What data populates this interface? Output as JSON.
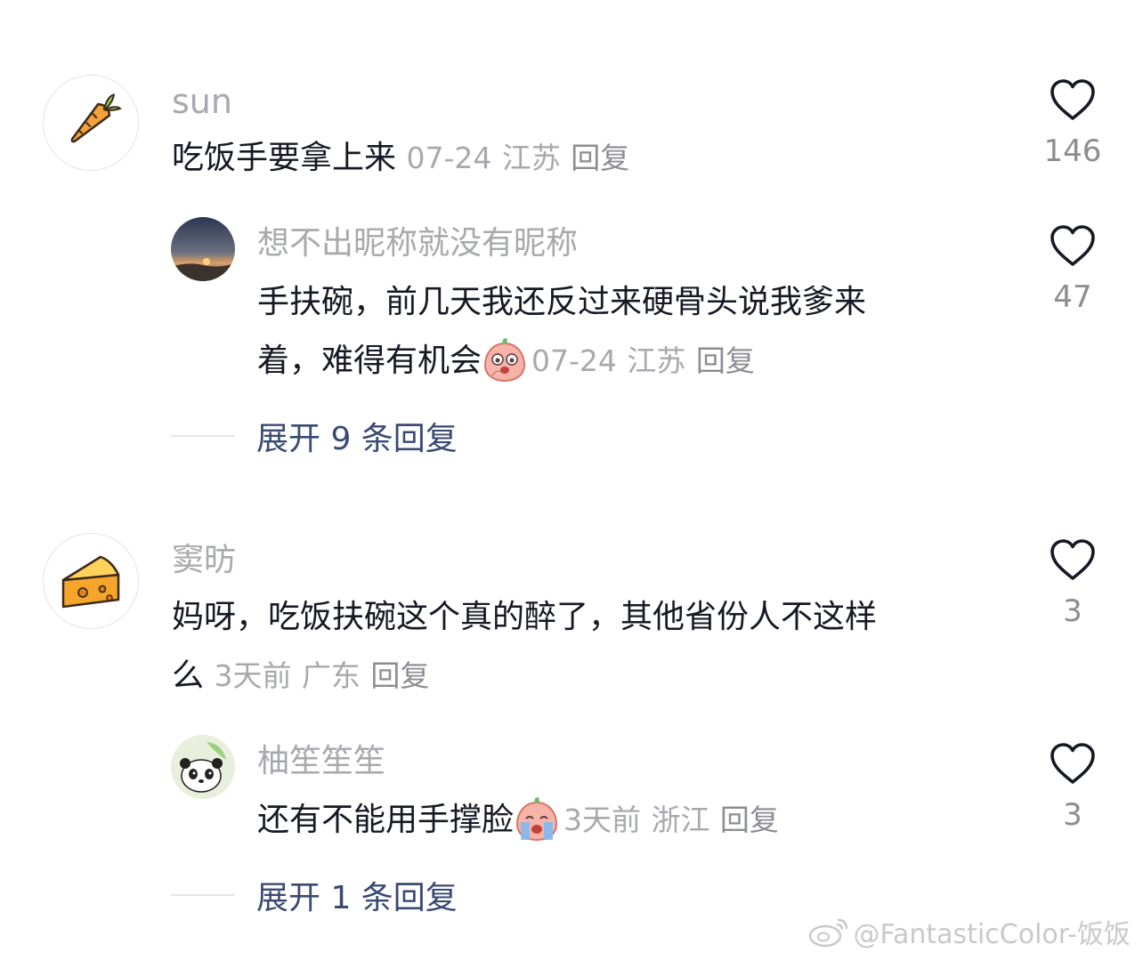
{
  "comments": [
    {
      "username": "sun",
      "avatar_icon": "carrot-icon",
      "text": "吃饭手要拿上来",
      "date": "07-24",
      "location": "江苏",
      "reply_label": "回复",
      "likes": "146",
      "replies": [
        {
          "username": "想不出昵称就没有昵称",
          "avatar_icon": "sunset-photo-avatar",
          "text_line1": "手扶碗，前几天我还反过来硬骨头说我爹来",
          "text_line2": "着，难得有机会",
          "emoji_icon": "shy-peach-emoji",
          "date": "07-24",
          "location": "江苏",
          "reply_label": "回复",
          "likes": "47"
        }
      ],
      "expand_label": "展开 9 条回复"
    },
    {
      "username": "窦昉",
      "avatar_icon": "cheese-icon",
      "text_line1": "妈呀，吃饭扶碗这个真的醉了，其他省份人不这样",
      "text_line2": "么",
      "date": "3天前",
      "location": "广东",
      "reply_label": "回复",
      "likes": "3",
      "replies": [
        {
          "username": "柚笙笙笙",
          "avatar_icon": "panda-avatar",
          "text": "还有不能用手撑脸",
          "emoji_icon": "crying-peach-emoji",
          "date": "3天前",
          "location": "浙江",
          "reply_label": "回复",
          "likes": "3"
        }
      ],
      "expand_label": "展开 1 条回复"
    }
  ],
  "watermark": "@FantasticColor-饭饭",
  "colors": {
    "meta": "#a8a9ae",
    "expand": "#3a4a73",
    "heart": "#161823"
  }
}
